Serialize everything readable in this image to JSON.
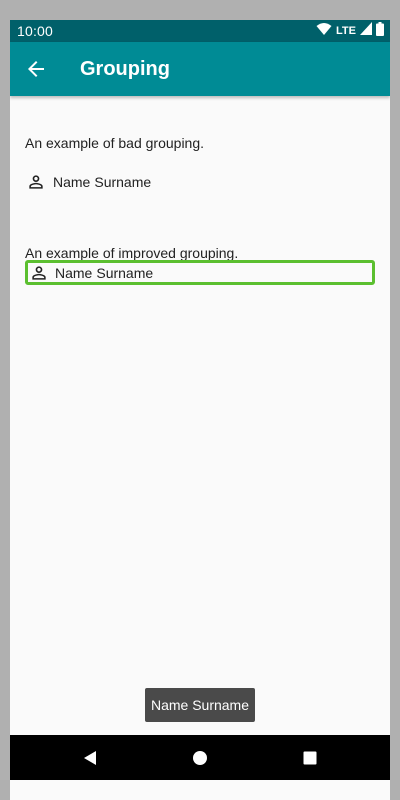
{
  "status_bar": {
    "time": "10:00",
    "network": "LTE",
    "icons": [
      "wifi-icon",
      "signal-icon",
      "battery-icon"
    ]
  },
  "app_bar": {
    "title": "Grouping",
    "back_icon": "arrow-back-icon"
  },
  "bad_example": {
    "label": "An example of bad grouping.",
    "first_name": "Name",
    "last_name": "Surname",
    "icon": "person-icon"
  },
  "improved_example": {
    "label": "An example of improved grouping.",
    "first_name": "Name",
    "last_name": "Surname",
    "icon": "person-icon",
    "focus_color": "#5bbf2f"
  },
  "toast": {
    "text": "Name Surname"
  },
  "nav_bar": {
    "icons": [
      "back-triangle-icon",
      "home-circle-icon",
      "recents-square-icon"
    ]
  },
  "colors": {
    "status_bar": "#00606a",
    "app_bar": "#008b95",
    "background": "#fafafa"
  }
}
